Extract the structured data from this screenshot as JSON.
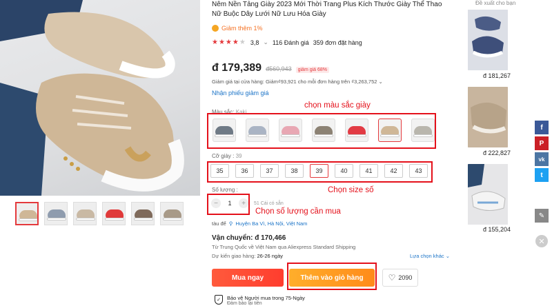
{
  "product": {
    "title": "Nêm Nền Tảng Giày 2023 Mới Thời Trang Plus Kích Thước Giày Thể Thao Nữ Buộc Dây Lưới Nữ Lưu Hóa Giày",
    "coupon_badge": "Giảm thêm 1%",
    "rating": "3,8",
    "stars_filled": 4,
    "reviews": "116 Đánh giá",
    "orders": "359 đơn đặt hàng",
    "price": "đ 179,389",
    "old_price": "đ560,943",
    "discount_tag": "giảm giá 68%",
    "store_discount": "Giảm giá tại cửa hàng: Giảm₫93,921 cho mỗi đơn hàng trên ₫3,263,752",
    "get_coupon": "Nhận phiếu giảm giá",
    "color_label": "Màu sắc:",
    "color_value": "Kaki",
    "size_label": "Cỡ giày :",
    "size_value": "39",
    "sizes": [
      "35",
      "36",
      "37",
      "38",
      "39",
      "40",
      "41",
      "42",
      "43"
    ],
    "selected_size": "39",
    "qty_label": "Số lượng :",
    "qty_value": "1",
    "qty_minus": "−",
    "qty_plus": "+",
    "stock": "51 Cái có sẵn",
    "ship_from_label": "tàu để",
    "ship_from_location": "Huyện Ba Vì, Hà Nội, Việt Nam",
    "shipping_title": "Vận chuyển: đ 170,466",
    "shipping_desc": "Từ Trung Quốc về Việt Nam qua Aliexpress Standard Shipping",
    "delivery_label": "Dự kiến giao hàng:",
    "delivery_value": "26-26 ngày",
    "shipping_more": "Lựa chọn khác",
    "buy_now": "Mua ngay",
    "add_to_cart": "Thêm vào giỏ hàng",
    "wishlist_count": "2090",
    "protection_title": "Bảo vệ Người mua trong 75-Ngày",
    "protection_sub": "Đảm bảo lại tiền"
  },
  "annotations": {
    "color": "chọn màu sắc giày",
    "size": "Chọn size số",
    "qty": "Chọn số lượng cần mua"
  },
  "recommend": {
    "label": "Đề xuất cho bạn",
    "items": [
      {
        "price": "đ 181,267"
      },
      {
        "price": "đ 222,827"
      },
      {
        "price": "đ 155,204"
      }
    ]
  },
  "social": [
    {
      "icon": "facebook-icon",
      "glyph": "f",
      "color": "#3b5998"
    },
    {
      "icon": "pinterest-icon",
      "glyph": "P",
      "color": "#cb2027"
    },
    {
      "icon": "vk-icon",
      "glyph": "vk",
      "color": "#4c75a3"
    },
    {
      "icon": "twitter-icon",
      "glyph": "t",
      "color": "#1da1f2"
    },
    {
      "icon": "edit-icon",
      "glyph": "✎",
      "color": "#888888"
    }
  ],
  "colors": {
    "accent_red": "#e4393c",
    "buy": "#ff3d2e",
    "cart": "#ff8b1a",
    "link": "#1a73c7"
  }
}
